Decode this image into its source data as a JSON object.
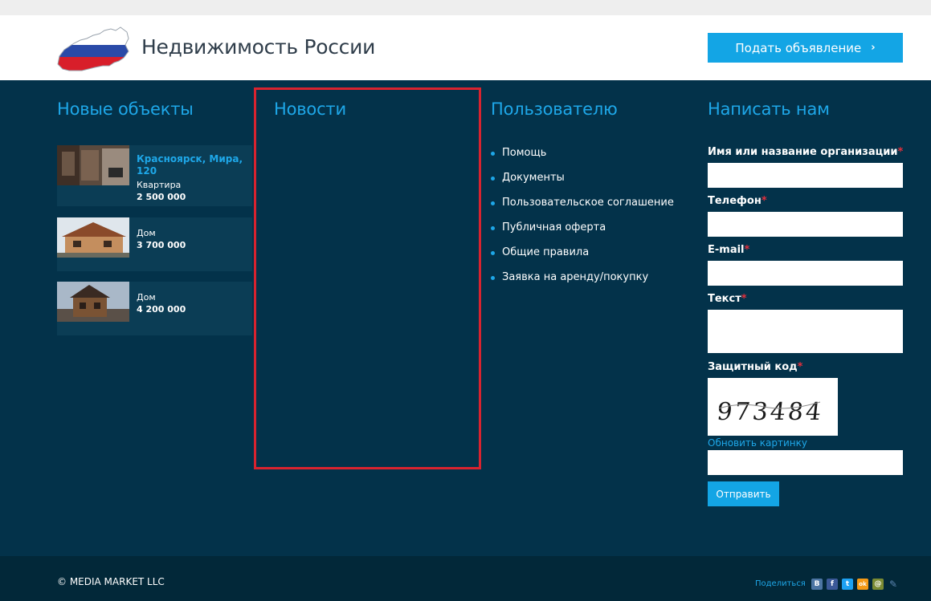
{
  "header": {
    "site_title": "Недвижимость России",
    "post_button": "Подать объявление",
    "chevron": "›"
  },
  "sections": {
    "new_objects": "Новые объекты",
    "news": "Новости",
    "user": "Пользователю",
    "contact": "Написать нам"
  },
  "objects": [
    {
      "location": "Красноярск, Мира, 120",
      "type": "Квартира",
      "price": "2 500 000"
    },
    {
      "location": "",
      "type": "Дом",
      "price": "3 700 000"
    },
    {
      "location": "",
      "type": "Дом",
      "price": "4 200 000"
    }
  ],
  "user_links": [
    "Помощь",
    "Документы",
    "Пользовательское соглашение",
    "Публичная оферта",
    "Общие правила",
    "Заявка на аренду/покупку"
  ],
  "form": {
    "name_label": "Имя или название организации",
    "phone_label": "Телефон",
    "email_label": "E-mail",
    "text_label": "Текст",
    "captcha_label": "Защитный код",
    "required_mark": "*",
    "captcha_code": "973484",
    "refresh_label": "Обновить картинку",
    "submit_label": "Отправить"
  },
  "footer": {
    "copyright": "© MEDIA MARKET LLC",
    "share_label": "Поделиться",
    "social": [
      {
        "icon": "vk-icon",
        "glyph": "В",
        "color": "#4c75a3"
      },
      {
        "icon": "facebook-icon",
        "glyph": "f",
        "color": "#3b5998"
      },
      {
        "icon": "twitter-icon",
        "glyph": "t",
        "color": "#1da1f2"
      },
      {
        "icon": "odnoklassniki-icon",
        "glyph": "ok",
        "color": "#f59a16"
      },
      {
        "icon": "mailru-icon",
        "glyph": "@",
        "color": "#7a8b33"
      },
      {
        "icon": "livejournal-icon",
        "glyph": "✎",
        "color": "#5d86b1"
      }
    ]
  },
  "colors": {
    "accent": "#13a5e5",
    "background": "#03324a",
    "required": "#e42f3c",
    "highlight_frame": "#d9232f"
  }
}
